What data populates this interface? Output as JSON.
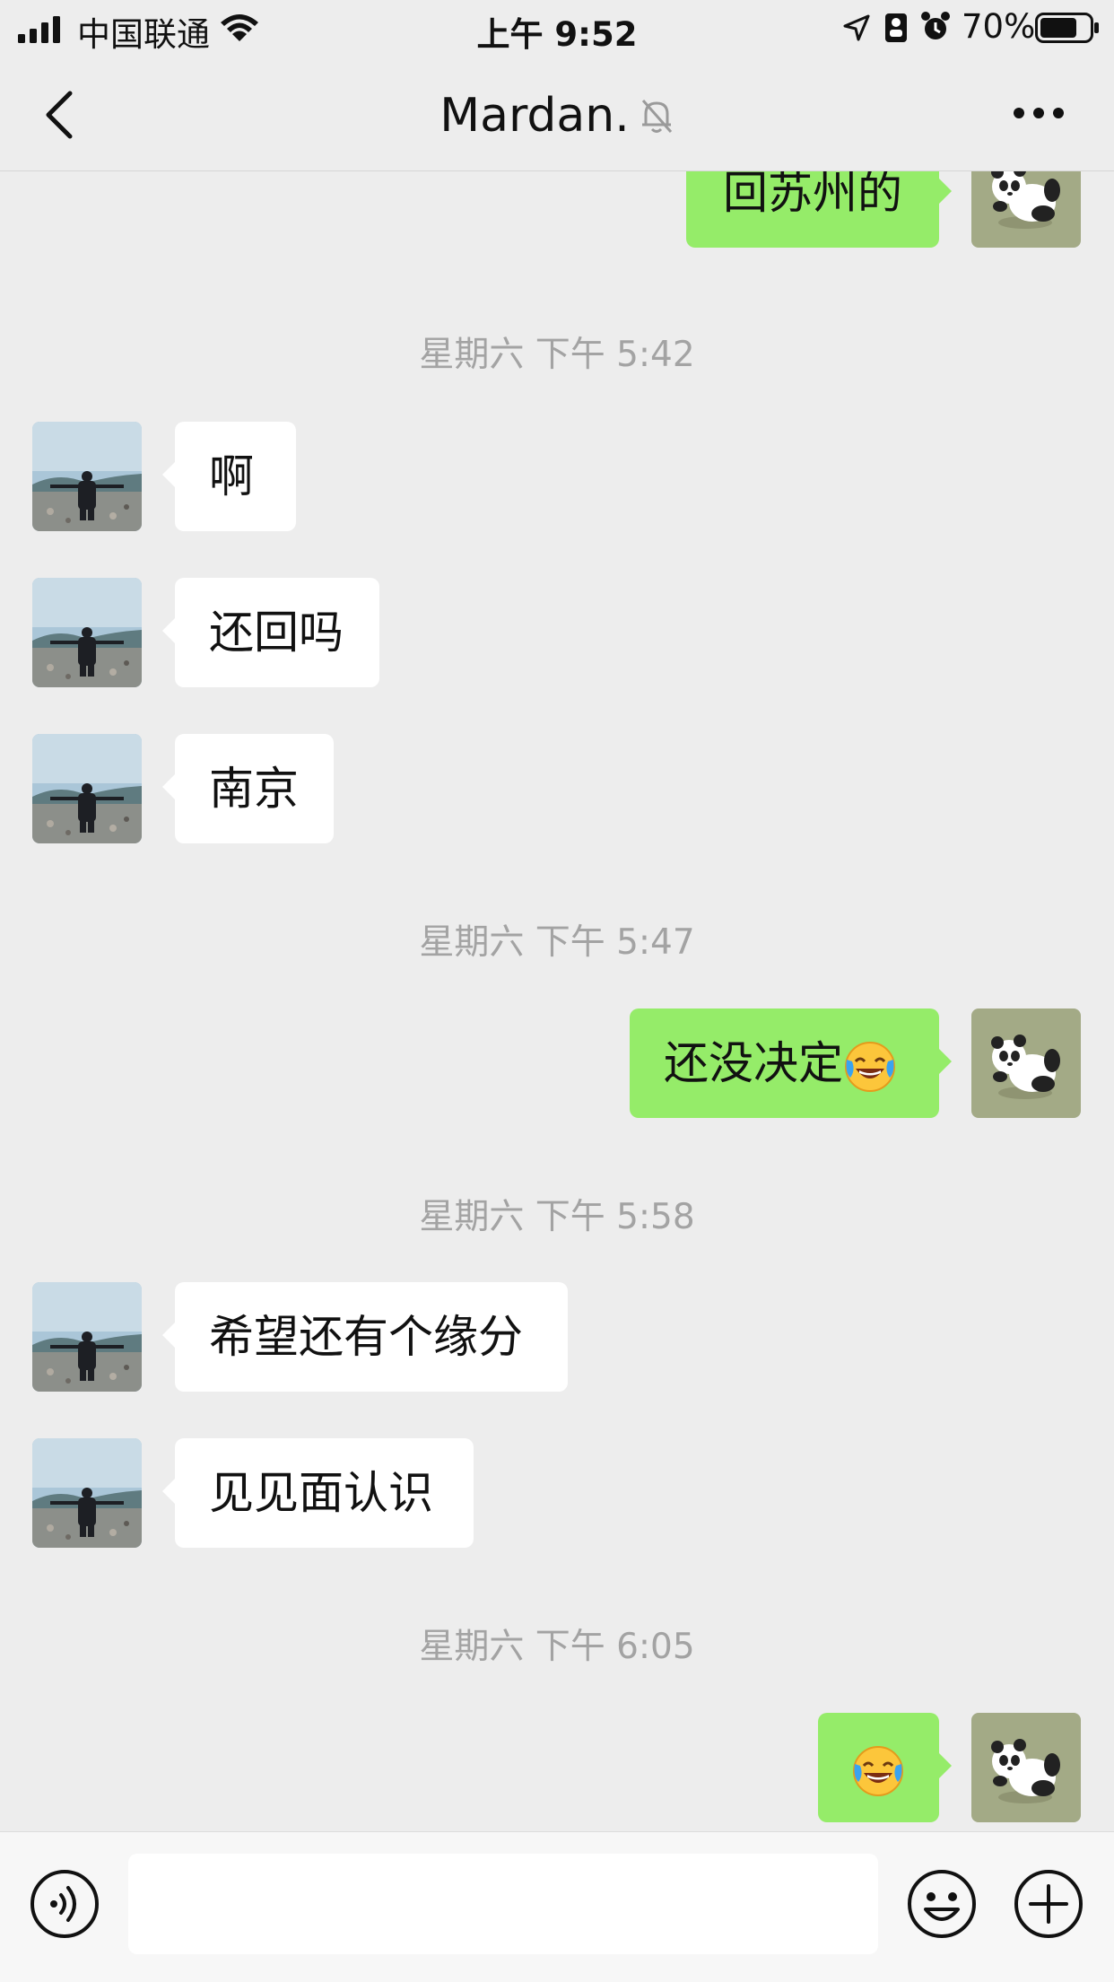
{
  "status_bar": {
    "carrier": "中国联通",
    "time": "上午 9:52",
    "battery": "70%"
  },
  "header": {
    "title": "Mardan.",
    "muted_icon": "bell-muted-icon"
  },
  "chat": {
    "timestamps": [
      "星期六 下午 5:42",
      "星期六 下午 5:47",
      "星期六 下午 5:58",
      "星期六 下午 6:05"
    ],
    "messages": [
      {
        "from": "me",
        "text": "回苏州的"
      },
      {
        "from": "contact",
        "text": "啊"
      },
      {
        "from": "contact",
        "text": "还回吗"
      },
      {
        "from": "contact",
        "text": "南京"
      },
      {
        "from": "me",
        "text": "还没决定",
        "emoji": "tears-of-joy-emoji"
      },
      {
        "from": "contact",
        "text": "希望还有个缘分"
      },
      {
        "from": "contact",
        "text": "见见面认识"
      },
      {
        "from": "me",
        "text": "",
        "emoji": "tears-of-joy-emoji"
      }
    ]
  },
  "input_bar": {
    "value": ""
  },
  "colors": {
    "background": "#ededed",
    "outgoing_bubble": "#95ec69",
    "incoming_bubble": "#ffffff",
    "timestamp_text": "#a3a3a3"
  }
}
